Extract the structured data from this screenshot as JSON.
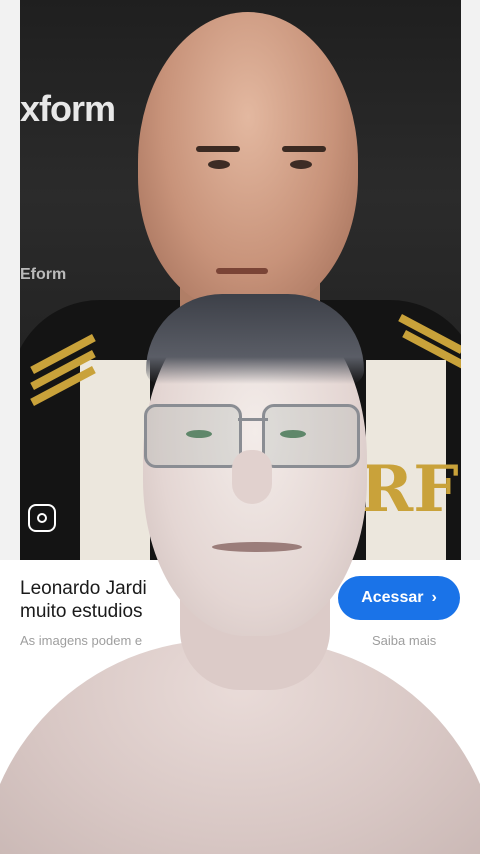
{
  "result_card": {
    "title_line1": "Leonardo Jardi",
    "title_line2": "muito estudios",
    "action_label": "Acessar",
    "disclaimer": "As imagens podem e",
    "learn_more": "Saiba mais"
  },
  "photo": {
    "backdrop_text": "xform",
    "backdrop_text_2": "Eform",
    "crest_text": "RF"
  },
  "colors": {
    "accent": "#1a73e8",
    "crest_gold": "#c9a23a"
  },
  "icons": {
    "lens": "google-lens-icon",
    "chevron": "chevron-right-icon"
  }
}
